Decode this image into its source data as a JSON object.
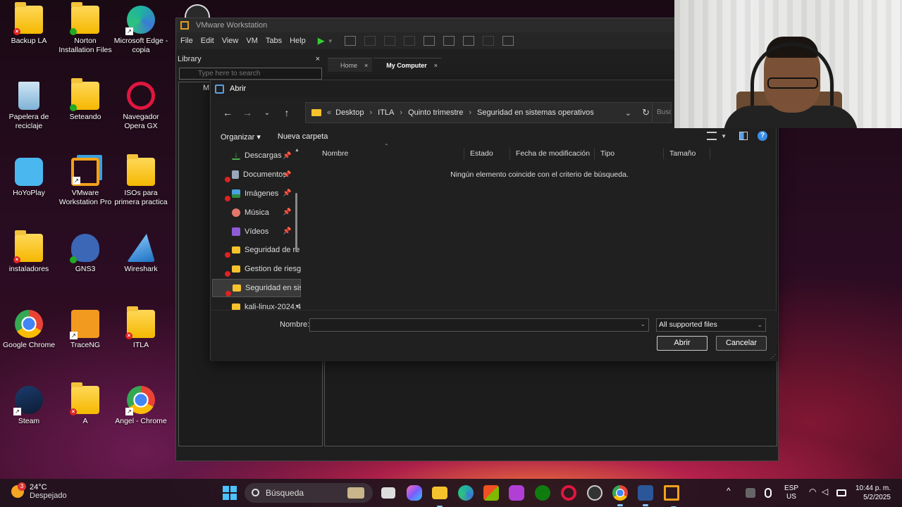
{
  "desktop": {
    "icons": [
      {
        "label": "Backup LA"
      },
      {
        "label": "Norton Installation Files"
      },
      {
        "label": "Microsoft Edge - copia"
      },
      {
        "label": "Papelera de reciclaje"
      },
      {
        "label": "Seteando"
      },
      {
        "label": "Navegador Opera GX"
      },
      {
        "label": "HoYoPlay"
      },
      {
        "label": "VMware Workstation Pro"
      },
      {
        "label": "ISOs para primera practica"
      },
      {
        "label": "instaladores"
      },
      {
        "label": "GNS3"
      },
      {
        "label": "Wireshark"
      },
      {
        "label": "Google Chrome"
      },
      {
        "label": "TraceNG"
      },
      {
        "label": "ITLA"
      },
      {
        "label": "Steam"
      },
      {
        "label": "A"
      },
      {
        "label": "Angel - Chrome"
      }
    ]
  },
  "vmware": {
    "title": "VMware Workstation",
    "menu": [
      "File",
      "Edit",
      "View",
      "VM",
      "Tabs",
      "Help"
    ],
    "library_label": "Library",
    "library_close": "×",
    "search_placeholder": "Type here to search",
    "tabs": [
      {
        "label": "Home",
        "close": "×"
      },
      {
        "label": "My Computer",
        "close": "×"
      }
    ],
    "tree_root": "M"
  },
  "dialog": {
    "title": "Abrir",
    "path": [
      "Desktop",
      "ITLA",
      "Quinto trimestre",
      "Seguridad en sistemas operativos"
    ],
    "path_prefix": "«",
    "search_placeholder": "Busca",
    "organize": "Organizar ▾",
    "new_folder": "Nueva carpeta",
    "nav_items": [
      {
        "label": "Descargas",
        "icon": "download-icon",
        "color": "#4caf50",
        "pinned": true,
        "error": false
      },
      {
        "label": "Documentos",
        "icon": "documents-icon",
        "color": "#9aa7b8",
        "pinned": true,
        "error": true
      },
      {
        "label": "Imágenes",
        "icon": "pictures-icon",
        "color": "#4aa3df",
        "pinned": true,
        "error": true
      },
      {
        "label": "Música",
        "icon": "music-icon",
        "color": "#e2776a",
        "pinned": true,
        "error": false
      },
      {
        "label": "Vídeos",
        "icon": "videos-icon",
        "color": "#8e5bd6",
        "pinned": true,
        "error": false
      },
      {
        "label": "Seguridad de re",
        "icon": "folder-icon",
        "color": "#f5c22e",
        "pinned": false,
        "error": true
      },
      {
        "label": "Gestion de riesg",
        "icon": "folder-icon",
        "color": "#f5c22e",
        "pinned": false,
        "error": true
      },
      {
        "label": "Seguridad en sis",
        "icon": "folder-icon",
        "color": "#f5c22e",
        "pinned": false,
        "error": true
      },
      {
        "label": "kali-linux-2024.4",
        "icon": "folder-icon",
        "color": "#f5c22e",
        "pinned": false,
        "error": false
      }
    ],
    "columns": [
      "Nombre",
      "Estado",
      "Fecha de modificación",
      "Tipo",
      "Tamaño"
    ],
    "empty_message": "Ningún elemento coincide con el criterio de búsqueda.",
    "name_label": "Nombre:",
    "name_value": "",
    "file_type": "All supported files",
    "open_button": "Abrir",
    "cancel_button": "Cancelar"
  },
  "taskbar": {
    "temperature": "24°C",
    "weather": "Despejado",
    "weather_badge": "3",
    "search": "Búsqueda",
    "lang_top": "ESP",
    "lang_bottom": "US",
    "time": "10:44 p. m.",
    "date": "5/2/2025"
  }
}
